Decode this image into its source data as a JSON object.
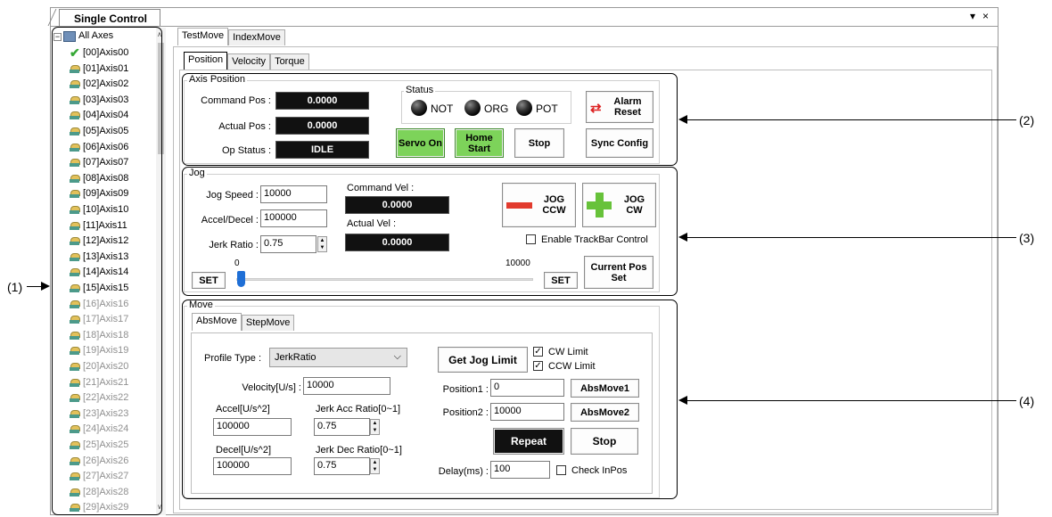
{
  "window": {
    "tab_title": "Single Control",
    "menu_arrow": "▾",
    "close": "×"
  },
  "tree": {
    "root": "All Axes",
    "items": [
      {
        "label": "[00]Axis00",
        "icon": "check-icon",
        "enabled": true
      },
      {
        "label": "[01]Axis01",
        "icon": "axis-icon",
        "enabled": true
      },
      {
        "label": "[02]Axis02",
        "icon": "axis-icon",
        "enabled": true
      },
      {
        "label": "[03]Axis03",
        "icon": "axis-icon",
        "enabled": true
      },
      {
        "label": "[04]Axis04",
        "icon": "axis-icon",
        "enabled": true
      },
      {
        "label": "[05]Axis05",
        "icon": "axis-icon",
        "enabled": true
      },
      {
        "label": "[06]Axis06",
        "icon": "axis-icon",
        "enabled": true
      },
      {
        "label": "[07]Axis07",
        "icon": "axis-icon",
        "enabled": true
      },
      {
        "label": "[08]Axis08",
        "icon": "axis-icon",
        "enabled": true
      },
      {
        "label": "[09]Axis09",
        "icon": "axis-icon",
        "enabled": true
      },
      {
        "label": "[10]Axis10",
        "icon": "axis-icon",
        "enabled": true
      },
      {
        "label": "[11]Axis11",
        "icon": "axis-icon",
        "enabled": true
      },
      {
        "label": "[12]Axis12",
        "icon": "axis-icon",
        "enabled": true
      },
      {
        "label": "[13]Axis13",
        "icon": "axis-icon",
        "enabled": true
      },
      {
        "label": "[14]Axis14",
        "icon": "axis-icon",
        "enabled": true
      },
      {
        "label": "[15]Axis15",
        "icon": "axis-icon",
        "enabled": true
      },
      {
        "label": "[16]Axis16",
        "icon": "axis-icon",
        "enabled": false
      },
      {
        "label": "[17]Axis17",
        "icon": "axis-icon",
        "enabled": false
      },
      {
        "label": "[18]Axis18",
        "icon": "axis-icon",
        "enabled": false
      },
      {
        "label": "[19]Axis19",
        "icon": "axis-icon",
        "enabled": false
      },
      {
        "label": "[20]Axis20",
        "icon": "axis-icon",
        "enabled": false
      },
      {
        "label": "[21]Axis21",
        "icon": "axis-icon",
        "enabled": false
      },
      {
        "label": "[22]Axis22",
        "icon": "axis-icon",
        "enabled": false
      },
      {
        "label": "[23]Axis23",
        "icon": "axis-icon",
        "enabled": false
      },
      {
        "label": "[24]Axis24",
        "icon": "axis-icon",
        "enabled": false
      },
      {
        "label": "[25]Axis25",
        "icon": "axis-icon",
        "enabled": false
      },
      {
        "label": "[26]Axis26",
        "icon": "axis-icon",
        "enabled": false
      },
      {
        "label": "[27]Axis27",
        "icon": "axis-icon",
        "enabled": false
      },
      {
        "label": "[28]Axis28",
        "icon": "axis-icon",
        "enabled": false
      },
      {
        "label": "[29]Axis29",
        "icon": "axis-icon",
        "enabled": false
      }
    ]
  },
  "main_tabs": [
    "TestMove",
    "IndexMove"
  ],
  "sub_tabs": [
    "Position",
    "Velocity",
    "Torque"
  ],
  "axis_position": {
    "title": "Axis Position",
    "command_pos_label": "Command Pos :",
    "command_pos": "0.0000",
    "actual_pos_label": "Actual Pos :",
    "actual_pos": "0.0000",
    "op_status_label": "Op Status :",
    "op_status": "IDLE",
    "status_title": "Status",
    "led_not": "NOT",
    "led_org": "ORG",
    "led_pot": "POT",
    "servo_on": "Servo On",
    "home_start": "Home Start",
    "stop": "Stop",
    "alarm_reset": "Alarm Reset",
    "sync_config": "Sync Config"
  },
  "jog": {
    "title": "Jog",
    "speed_label": "Jog Speed :",
    "speed": "10000",
    "accel_label": "Accel/Decel :",
    "accel": "100000",
    "jerk_label": "Jerk Ratio :",
    "jerk": "0.75",
    "cmd_vel_label": "Command Vel :",
    "cmd_vel": "0.0000",
    "act_vel_label": "Actual Vel :",
    "act_vel": "0.0000",
    "jog_ccw": "JOG CCW",
    "jog_cw": "JOG CW",
    "trackbar_label": "Enable TrackBar Control",
    "trackbar_checked": false,
    "slider_min": "0",
    "slider_max": "10000",
    "slider_value": 0,
    "set_left": "SET",
    "set_right": "SET",
    "current_pos_set": "Current Pos Set"
  },
  "move": {
    "title": "Move",
    "tabs": [
      "AbsMove",
      "StepMove"
    ],
    "profile_label": "Profile Type :",
    "profile_value": "JerkRatio",
    "velocity_label": "Velocity[U/s] :",
    "velocity": "10000",
    "accel_label": "Accel[U/s^2]",
    "accel": "100000",
    "jerk_acc_label": "Jerk Acc Ratio[0~1]",
    "jerk_acc": "0.75",
    "decel_label": "Decel[U/s^2]",
    "decel": "100000",
    "jerk_dec_label": "Jerk Dec Ratio[0~1]",
    "jerk_dec": "0.75",
    "get_jog_limit": "Get Jog Limit",
    "cw_limit": "CW Limit",
    "ccw_limit": "CCW Limit",
    "pos1_label": "Position1 :",
    "pos1": "0",
    "absmove1": "AbsMove1",
    "pos2_label": "Position2 :",
    "pos2": "10000",
    "absmove2": "AbsMove2",
    "repeat": "Repeat",
    "stop": "Stop",
    "delay_label": "Delay(ms) :",
    "delay": "100",
    "check_inpos": "Check InPos"
  },
  "callouts": {
    "c1": "(1)",
    "c2": "(2)",
    "c3": "(3)",
    "c4": "(4)"
  }
}
